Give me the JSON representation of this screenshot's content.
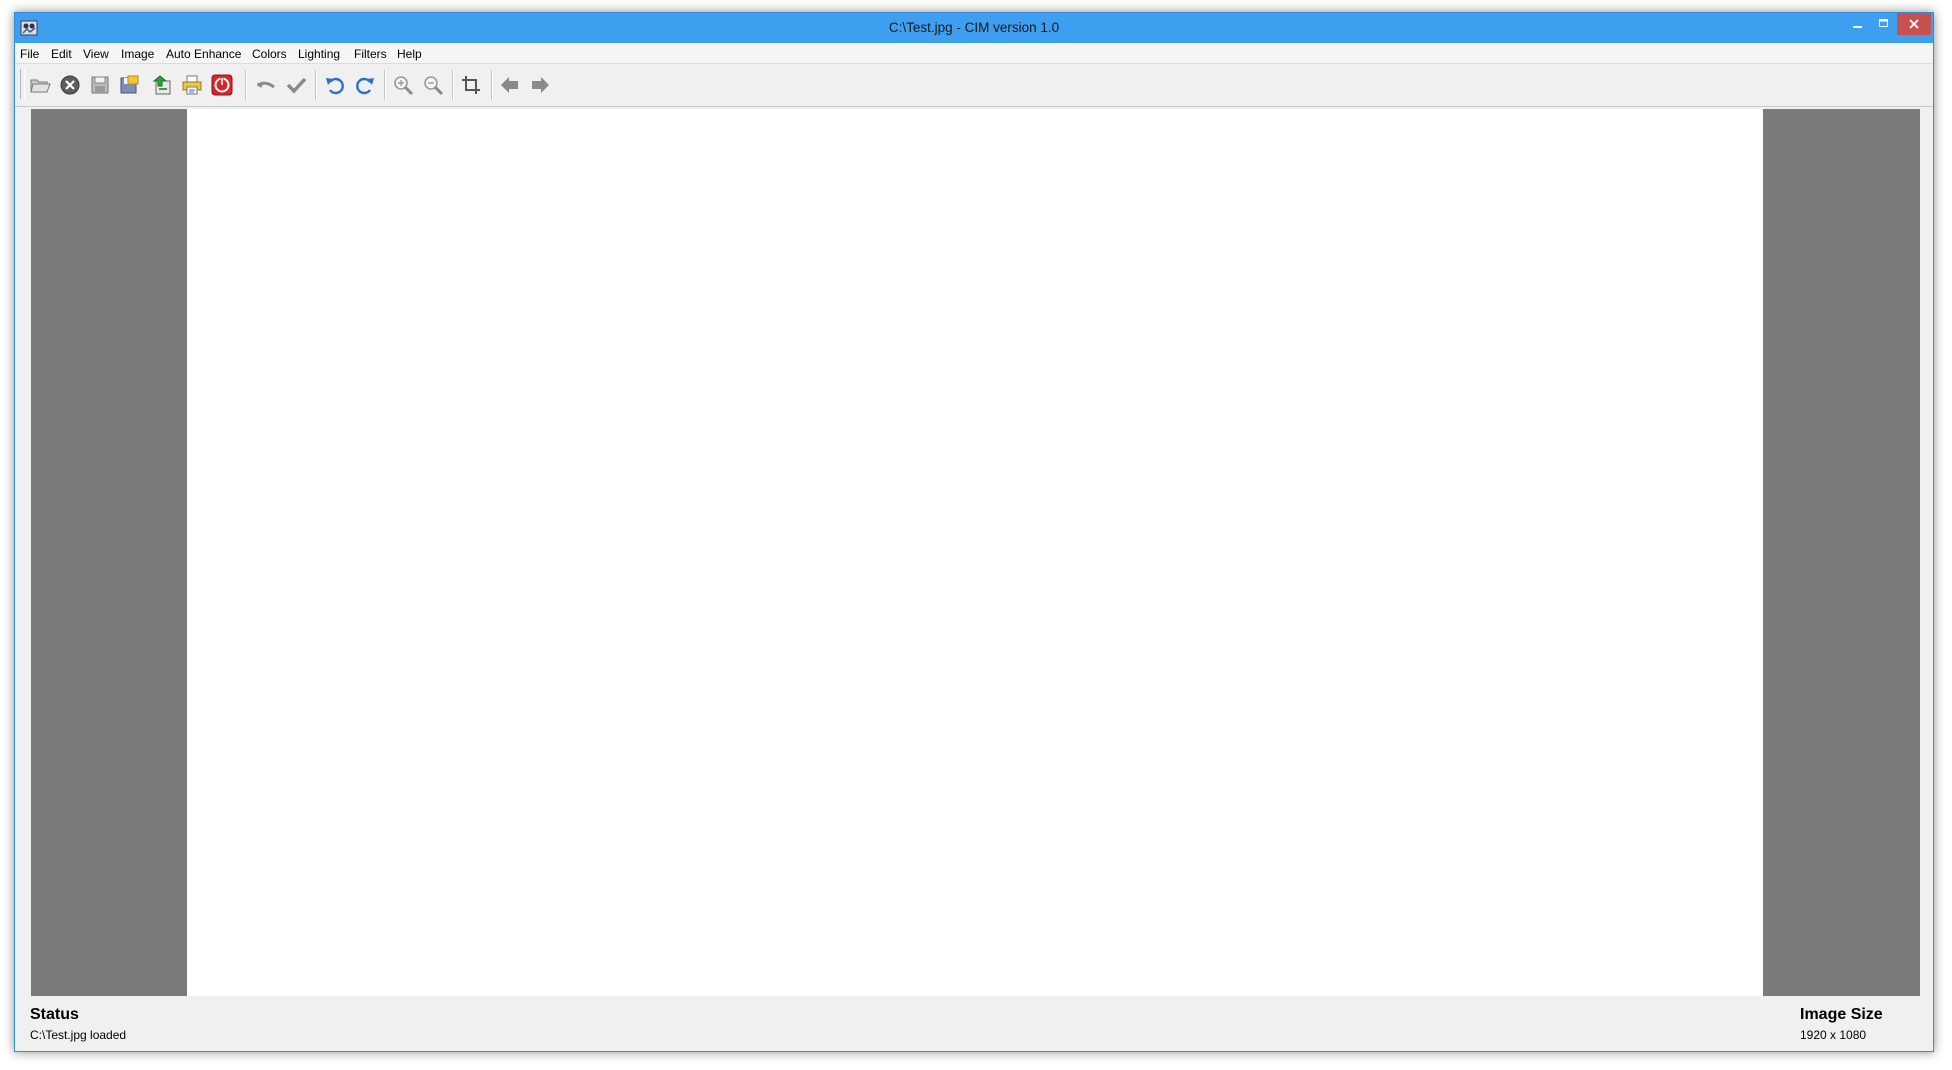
{
  "window": {
    "title": "C:\\Test.jpg - CIM version 1.0"
  },
  "menu": [
    {
      "label": "File"
    },
    {
      "label": "Edit"
    },
    {
      "label": "View"
    },
    {
      "label": "Image"
    },
    {
      "label": "Auto Enhance"
    },
    {
      "label": "Colors"
    },
    {
      "label": "Lighting"
    },
    {
      "label": "Filters"
    },
    {
      "label": "Help"
    }
  ],
  "toolbar": {
    "buttons": [
      {
        "icon": "open-folder-icon"
      },
      {
        "icon": "close-circle-icon"
      },
      {
        "icon": "save-icon"
      },
      {
        "icon": "save-as-icon"
      },
      {
        "icon": "export-icon"
      },
      {
        "icon": "print-icon"
      },
      {
        "icon": "exit-power-icon"
      },
      {
        "icon": "cancel-icon"
      },
      {
        "icon": "apply-check-icon"
      },
      {
        "icon": "undo-icon"
      },
      {
        "icon": "redo-icon"
      },
      {
        "icon": "zoom-in-icon"
      },
      {
        "icon": "zoom-out-icon"
      },
      {
        "icon": "crop-icon"
      },
      {
        "icon": "previous-arrow-icon"
      },
      {
        "icon": "next-arrow-icon"
      }
    ]
  },
  "status": {
    "heading": "Status",
    "message": "C:\\Test.jpg loaded"
  },
  "image_size": {
    "heading": "Image Size",
    "value": "1920 x 1080"
  },
  "colors": {
    "titlebar": "#3e9ff0",
    "close_button": "#c75050",
    "canvas_background": "#7a7a7a",
    "image": "#ffffff"
  }
}
